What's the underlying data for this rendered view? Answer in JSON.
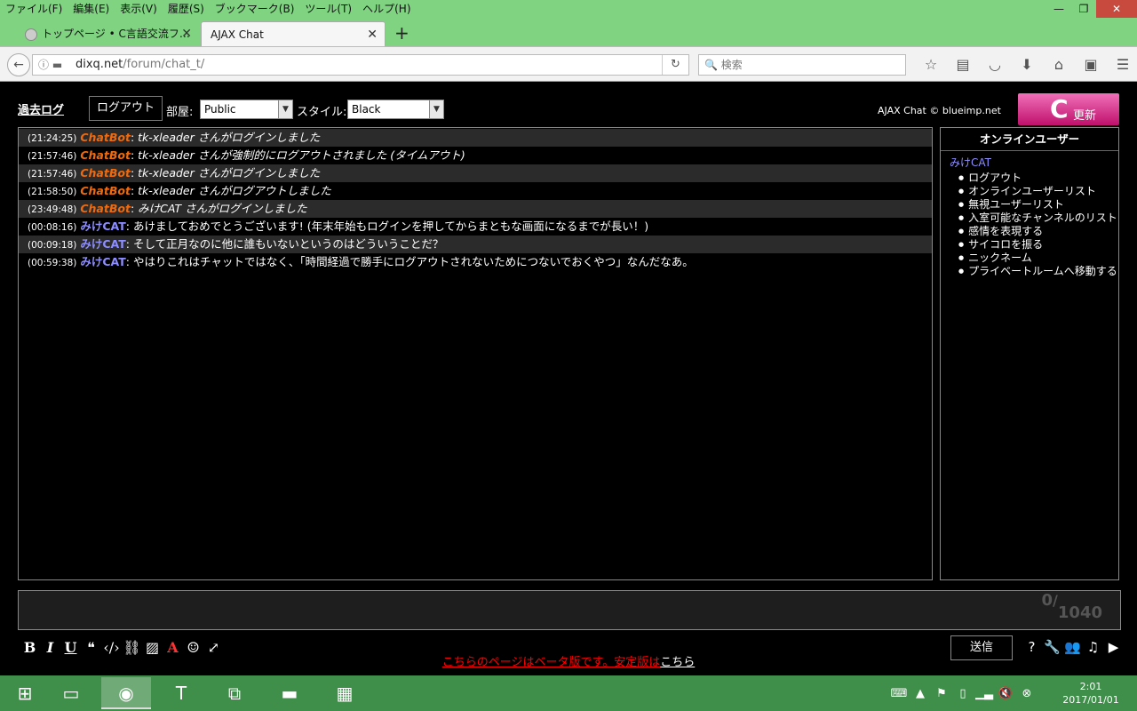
{
  "browser": {
    "menu": [
      "ファイル(F)",
      "編集(E)",
      "表示(V)",
      "履歴(S)",
      "ブックマーク(B)",
      "ツール(T)",
      "ヘルプ(H)"
    ],
    "window_controls": {
      "minimize": "—",
      "maximize": "❐",
      "close": "✕"
    },
    "tabs": [
      {
        "title": "トップページ • C言語交流フ…"
      },
      {
        "title": "AJAX Chat"
      }
    ],
    "new_tab": "+",
    "url": {
      "host": "dixq.net",
      "path": "/forum/chat_t/"
    },
    "search_placeholder": "検索"
  },
  "chat": {
    "logs_link": "過去ログ",
    "logout_button": "ログアウト",
    "room_label": "部屋:",
    "room_value": "Public",
    "style_label": "スタイル:",
    "style_value": "Black",
    "copyright": "AJAX Chat © blueimp.net",
    "refresh_label": "更新",
    "messages": [
      {
        "time": "(21:24:25)",
        "user": "ChatBot",
        "text": "tk-xleader さんがログインしました",
        "bot": true
      },
      {
        "time": "(21:57:46)",
        "user": "ChatBot",
        "text": "tk-xleader さんが強制的にログアウトされました (タイムアウト)",
        "bot": true
      },
      {
        "time": "(21:57:46)",
        "user": "ChatBot",
        "text": "tk-xleader さんがログインしました",
        "bot": true
      },
      {
        "time": "(21:58:50)",
        "user": "ChatBot",
        "text": "tk-xleader さんがログアウトしました",
        "bot": true
      },
      {
        "time": "(23:49:48)",
        "user": "ChatBot",
        "text": "みけCAT さんがログインしました",
        "bot": true
      },
      {
        "time": "(00:08:16)",
        "user": "みけCAT",
        "text": "あけましておめでとうございます! (年末年始もログインを押してからまともな画面になるまでが長い！)",
        "bot": false
      },
      {
        "time": "(00:09:18)",
        "user": "みけCAT",
        "text": "そして正月なのに他に誰もいないというのはどういうことだ？",
        "bot": false
      },
      {
        "time": "(00:59:38)",
        "user": "みけCAT",
        "text": "やはりこれはチャットではなく、「時間経過で勝手にログアウトされないためにつないでおくやつ」なんだなあ。",
        "bot": false
      }
    ],
    "online": {
      "title": "オンラインユーザー",
      "user": "みけCAT",
      "commands": [
        "ログアウト",
        "オンラインユーザーリスト",
        "無視ユーザーリスト",
        "入室可能なチャンネルのリスト",
        "感情を表現する",
        "サイコロを振る",
        "ニックネーム",
        "プライベートルームへ移動する"
      ]
    },
    "counter": {
      "current": "0",
      "max": "1040"
    },
    "send_button": "送信",
    "beta_notice": "こちらのページはベータ版です。安定版は",
    "beta_link": "こちら"
  },
  "taskbar": {
    "clock_time": "2:01",
    "clock_date": "2017/01/01"
  }
}
